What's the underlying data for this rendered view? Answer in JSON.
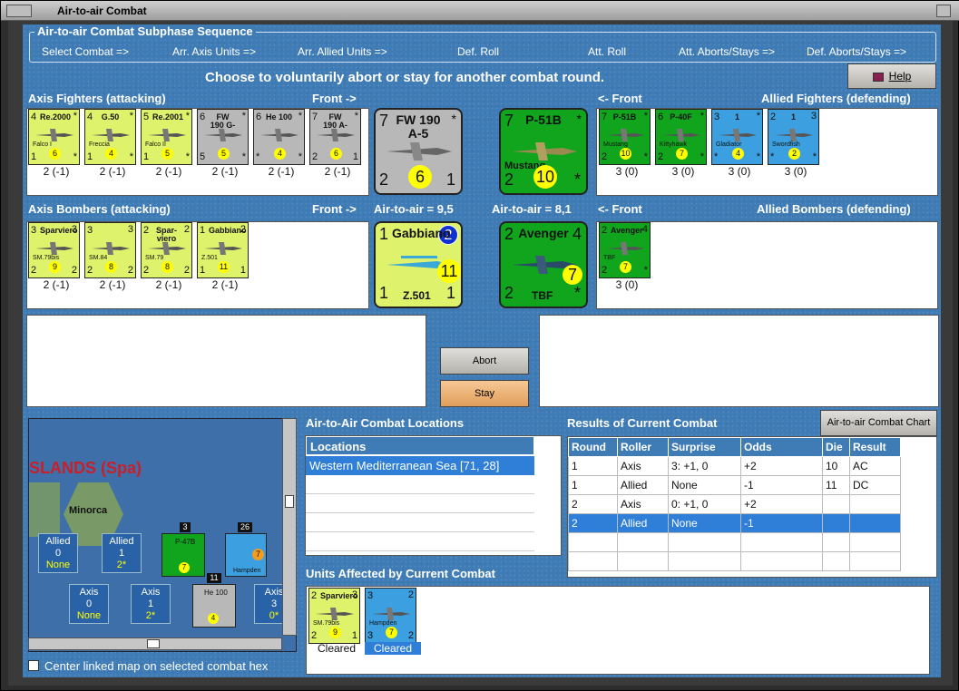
{
  "window": {
    "title": "Air-to-air Combat"
  },
  "sequence": {
    "title": "Air-to-air Combat Subphase Sequence",
    "steps": [
      "Select Combat =>",
      "Arr. Axis Units =>",
      "Arr. Allied Units =>",
      "Def. Roll",
      "Att. Roll",
      "Att. Aborts/Stays =>",
      "Def. Aborts/Stays =>"
    ]
  },
  "instruction": "Choose to voluntarily abort or stay for another combat round.",
  "help_label": "Help",
  "labels": {
    "axis_fighters": "Axis Fighters (attacking)",
    "front_right": "Front ->",
    "front_left": "<- Front",
    "allied_fighters": "Allied Fighters (defending)",
    "axis_bombers": "Axis Bombers (attacking)",
    "allied_bombers": "Allied Bombers (defending)",
    "axis_a2a": "Air-to-air = 9,5",
    "allied_a2a": "Air-to-air = 8,1"
  },
  "axis_fighters": [
    {
      "tl": "4",
      "name": "Re.2000",
      "sub": "Falco I",
      "tr": "*",
      "bl": "1",
      "circ": "6",
      "br": "*",
      "cap": "2 (-1)"
    },
    {
      "tl": "4",
      "name": "G.50",
      "sub": "Freccia",
      "tr": "*",
      "bl": "1",
      "circ": "4",
      "br": "*",
      "cap": "2 (-1)"
    },
    {
      "tl": "5",
      "name": "Re.2001",
      "sub": "Falco II",
      "tr": "*",
      "bl": "1",
      "circ": "5",
      "br": "*",
      "cap": "2 (-1)"
    },
    {
      "tl": "6",
      "name": "FW 190 G-3",
      "sub": "",
      "tr": "*",
      "bl": "5",
      "circ": "5",
      "br": "*",
      "cap": "2 (-1)"
    },
    {
      "tl": "6",
      "name": "He 100",
      "sub": "",
      "tr": "*",
      "bl": "*",
      "circ": "4",
      "br": "*",
      "cap": "2 (-1)"
    },
    {
      "tl": "7",
      "name": "FW 190 A-5",
      "sub": "",
      "tr": "*",
      "bl": "2",
      "circ": "6",
      "br": "1",
      "cap": "2 (-1)"
    }
  ],
  "allied_fighters": [
    {
      "tl": "7",
      "name": "P-51B",
      "sub": "Mustang",
      "tr": "*",
      "bl": "2",
      "circ": "10",
      "br": "*",
      "cap": "3 (0)"
    },
    {
      "tl": "6",
      "name": "P-40F",
      "sub": "Kittyhawk",
      "tr": "*",
      "bl": "2",
      "circ": "7",
      "br": "*",
      "cap": "3 (0)"
    },
    {
      "tl": "3",
      "name": "1",
      "sub": "Gladiator",
      "tr": "*",
      "bl": "*",
      "circ": "4",
      "br": "*",
      "cap": "3 (0)"
    },
    {
      "tl": "2",
      "name": "1",
      "sub": "Swordfish",
      "tr": "3",
      "bl": "*",
      "circ": "2",
      "br": "*",
      "cap": "3 (0)"
    }
  ],
  "axis_bombers": [
    {
      "tl": "3",
      "name": "Sparviero",
      "sub": "SM.79bis",
      "tr": "3",
      "bl": "2",
      "circ": "9",
      "br": "2",
      "cap": "2 (-1)"
    },
    {
      "tl": "3",
      "name": "",
      "sub": "SM.84",
      "tr": "3",
      "bl": "2",
      "circ": "8",
      "br": "2",
      "cap": "2 (-1)"
    },
    {
      "tl": "2",
      "name": "Spar-viero",
      "sub": "SM.79",
      "tr": "2",
      "bl": "2",
      "circ": "8",
      "br": "2",
      "cap": "2 (-1)"
    },
    {
      "tl": "1",
      "name": "Gabbiano",
      "sub": "Z.501",
      "tr": "2",
      "bl": "1",
      "circ": "11",
      "br": "1",
      "cap": "2 (-1)"
    }
  ],
  "allied_bombers": [
    {
      "tl": "2",
      "name": "Avenger",
      "sub": "TBF",
      "tr": "4",
      "bl": "2",
      "circ": "7",
      "br": "*",
      "cap": "3 (0)"
    }
  ],
  "front_axis_fighter": {
    "tl": "7",
    "name": "FW 190 A-5",
    "tr": "*",
    "bl": "2",
    "circ": "6",
    "br": "1"
  },
  "front_allied_fighter": {
    "tl": "7",
    "name": "P-51B",
    "sub": "Mustang",
    "tr": "*",
    "bl": "2",
    "circ": "10",
    "br": "*"
  },
  "front_axis_bomber": {
    "tl": "1",
    "name": "Gabbiano",
    "tr": "2",
    "sub": "Z.501",
    "bl": "1",
    "circ": "11",
    "br": "1"
  },
  "front_allied_bomber": {
    "tl": "2",
    "name": "Avenger",
    "sub": "TBF",
    "tr": "4",
    "bl": "2",
    "circ": "7",
    "br": "*"
  },
  "buttons": {
    "abort": "Abort",
    "stay": "Stay",
    "chart": "Air-to-air Combat Chart"
  },
  "locations": {
    "title": "Air-to-Air Combat Locations",
    "header": "Locations",
    "items": [
      "Western Mediterranean Sea [71, 28]"
    ]
  },
  "results": {
    "title": "Results of Current Combat",
    "columns": [
      "Round",
      "Roller",
      "Surprise",
      "Odds",
      "Die",
      "Result"
    ],
    "rows": [
      [
        "1",
        "Axis",
        "3: +1, 0",
        "+2",
        "10",
        "AC"
      ],
      [
        "1",
        "Allied",
        "None",
        "-1",
        "11",
        "DC"
      ],
      [
        "2",
        "Axis",
        "0: +1, 0",
        "+2",
        "",
        ""
      ],
      [
        "2",
        "Allied",
        "None",
        "-1",
        "",
        ""
      ]
    ]
  },
  "affected": {
    "title": "Units Affected by Current Combat",
    "units": [
      {
        "tl": "2",
        "name": "Sparviero",
        "sub": "SM.79bis",
        "tr": "3",
        "bl": "2",
        "circ": "9",
        "br": "1",
        "status": "Cleared"
      },
      {
        "tl": "3",
        "name": "",
        "sub": "Hampden",
        "tr": "2",
        "bl": "3",
        "circ": "7",
        "br": "2",
        "status": "Cleared"
      }
    ]
  },
  "map": {
    "region": "SLANDS (Spa)",
    "island": "Minorca",
    "allied_stats": [
      {
        "label": "Allied",
        "num": "0",
        "val": "None"
      },
      {
        "label": "Allied",
        "num": "1",
        "val": "2*"
      }
    ],
    "axis_stats": [
      {
        "label": "Axis",
        "num": "0",
        "val": "None"
      },
      {
        "label": "Axis",
        "num": "1",
        "val": "2*"
      },
      {
        "label": "Axis",
        "num": "3",
        "val": "0*"
      }
    ],
    "stack_counts": [
      "3",
      "26",
      "11"
    ],
    "map_units": [
      {
        "name": "P-47B",
        "circ": "7"
      },
      {
        "name": "Hampden",
        "circ": "7"
      },
      {
        "name": "He 100",
        "circ": "4"
      }
    ]
  },
  "center_linked": "Center linked map on selected combat hex"
}
